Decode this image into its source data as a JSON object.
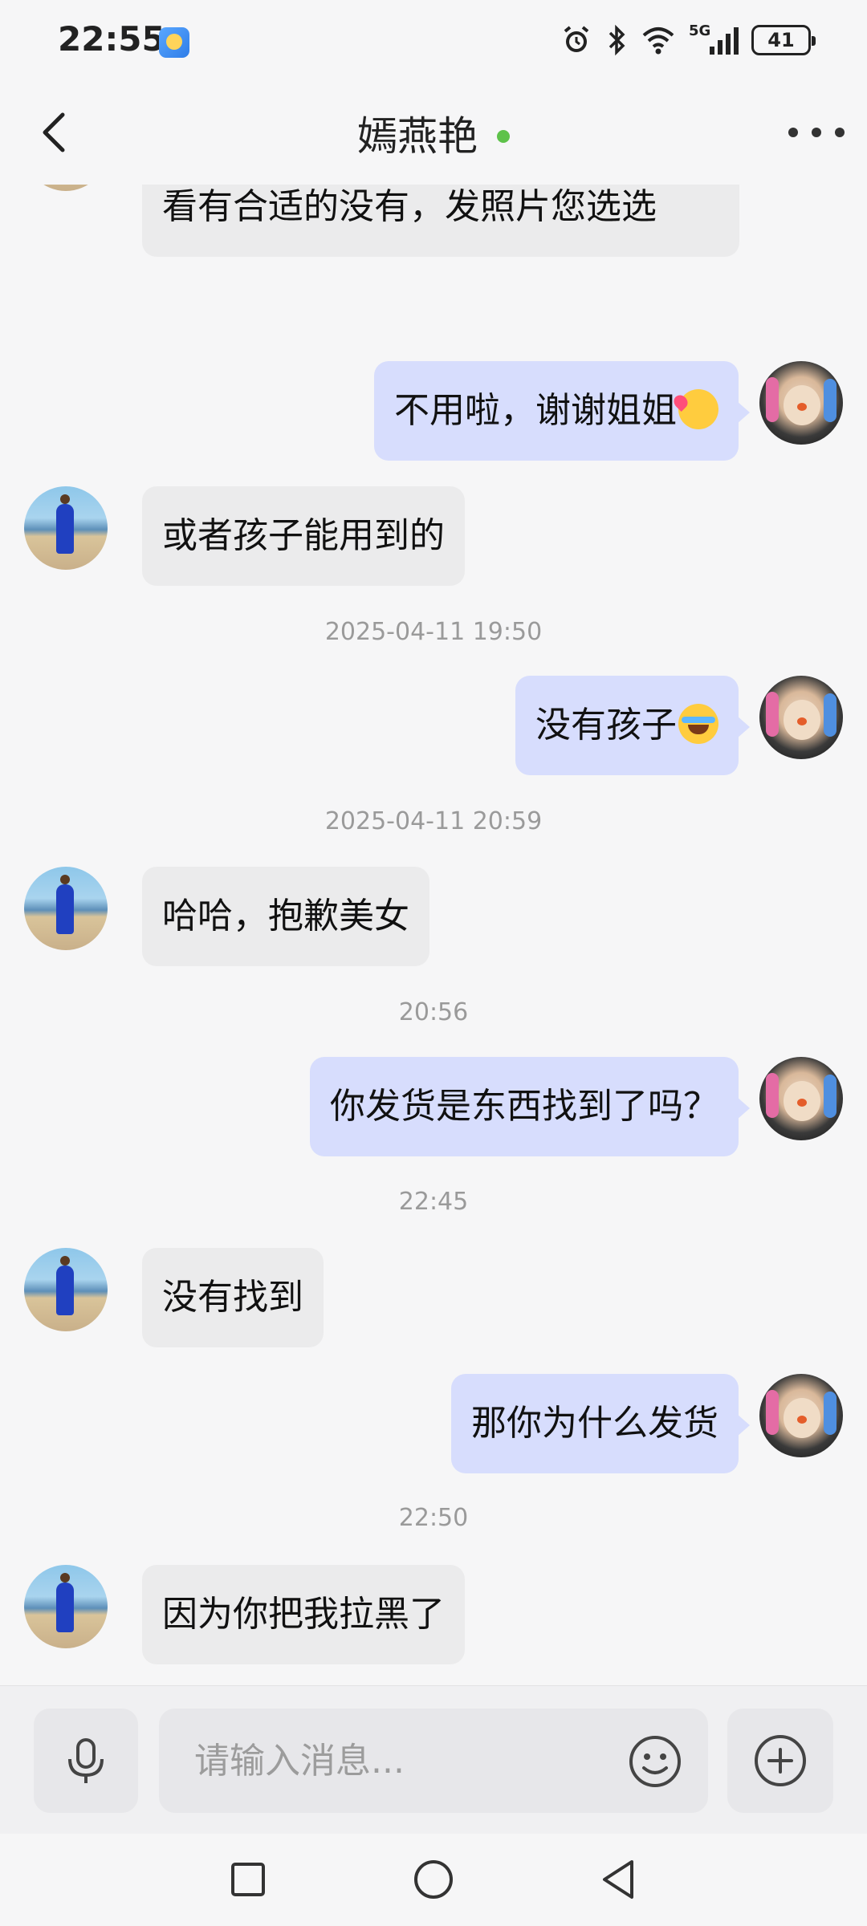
{
  "status_bar": {
    "time": "22:55",
    "network_label": "5G",
    "battery": "41",
    "icons": [
      "weather-icon",
      "alarm-icon",
      "bluetooth-icon",
      "wifi-icon",
      "signal-icon",
      "battery-icon"
    ]
  },
  "header": {
    "title": "嫣燕艳",
    "online_color": "#5ec24a"
  },
  "messages": [
    {
      "side": "them",
      "text": "您穿多大码的衣服或者鞋子？我看看有合适的没有，发照片您选选",
      "visible_text_lines": [
        "看看有合适的没有，发照片您选",
        "选"
      ]
    },
    {
      "side": "me",
      "text": "不用啦，谢谢姐姐",
      "emoji": "kiss-emoji"
    },
    {
      "side": "them",
      "text": "或者孩子能用到的"
    },
    {
      "timestamp": "2025-04-11 19:50"
    },
    {
      "side": "me",
      "text": "没有孩子",
      "emoji": "crying-emoji"
    },
    {
      "timestamp": "2025-04-11 20:59"
    },
    {
      "side": "them",
      "text": "哈哈，抱歉美女"
    },
    {
      "timestamp": "20:56"
    },
    {
      "side": "me",
      "text": "你发货是东西找到了吗？"
    },
    {
      "timestamp": "22:45"
    },
    {
      "side": "them",
      "text": "没有找到"
    },
    {
      "side": "me",
      "text": "那你为什么发货"
    },
    {
      "timestamp": "22:50"
    },
    {
      "side": "them",
      "text": "因为你把我拉黑了"
    }
  ],
  "input": {
    "placeholder": "请输入消息..."
  },
  "colors": {
    "my_bubble": "#d7ddfd",
    "their_bubble": "#ebebec",
    "background": "#f6f6f7"
  }
}
